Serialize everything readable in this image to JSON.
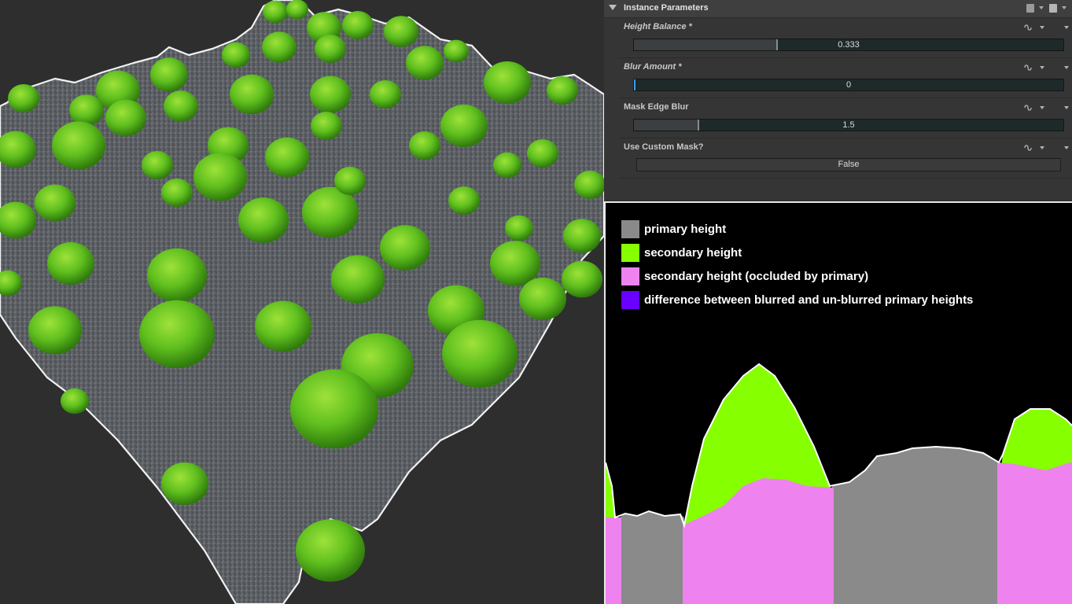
{
  "panel": {
    "title": "Instance Parameters",
    "header_icons": [
      "document-icon",
      "folder-icon"
    ],
    "params": [
      {
        "label": "Height Balance *",
        "value": "0.333",
        "fraction": 0.333,
        "italic": true
      },
      {
        "label": "Blur Amount *",
        "value": "0",
        "fraction": 0.0,
        "italic": true
      },
      {
        "label": "Mask Edge Blur",
        "value": "1.5",
        "fraction": 0.15,
        "italic": false
      },
      {
        "label": "Use Custom Mask?",
        "value": "False",
        "italic": false
      }
    ]
  },
  "legend": [
    {
      "label": "primary height",
      "color": "#8a8a8a"
    },
    {
      "label": "secondary height",
      "color": "#86ff00"
    },
    {
      "label": "secondary height (occluded by primary)",
      "color": "#ee82ee"
    },
    {
      "label": "difference between blurred and un-blurred primary heights",
      "color": "#6a00ff"
    }
  ],
  "colors": {
    "viewport_bg": "#2e2e2e",
    "terrain": "#5f6266",
    "moss": "#5fbf1e",
    "diagram_bg": "#000000"
  }
}
